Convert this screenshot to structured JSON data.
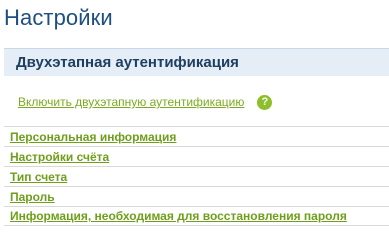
{
  "page": {
    "title": "Настройки"
  },
  "section": {
    "title": "Двухэтапная аутентификация",
    "enable_link": "Включить двухэтапную аутентификацию",
    "help_icon": "question-mark-icon",
    "help_glyph": "?"
  },
  "settings_links": [
    {
      "label": "Персональная информация"
    },
    {
      "label": "Настройки счёта"
    },
    {
      "label": "Тип счета"
    },
    {
      "label": "Пароль"
    },
    {
      "label": "Информация, необходимая для восстановления пароля"
    }
  ],
  "colors": {
    "title": "#1e4f82",
    "header_background": "#e5eef6",
    "link_green": "#7aab1f",
    "help_icon": "#8cbf2a"
  }
}
